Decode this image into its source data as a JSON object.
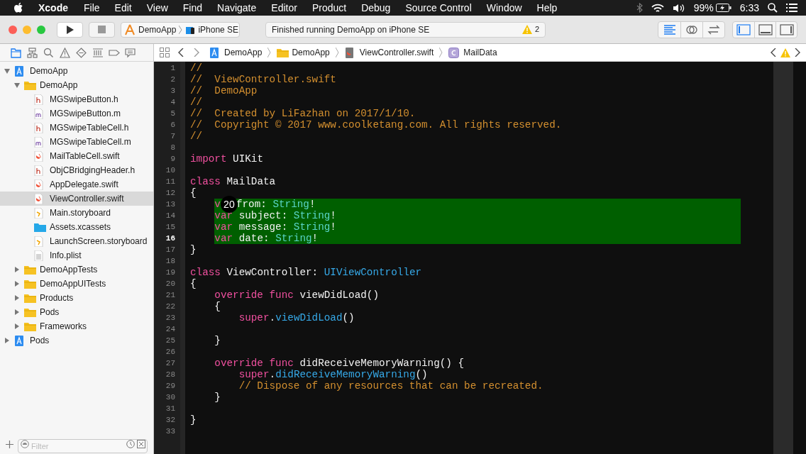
{
  "menu_bar": {
    "app": "Xcode",
    "items": [
      "File",
      "Edit",
      "View",
      "Find",
      "Navigate",
      "Editor",
      "Product",
      "Debug",
      "Source Control",
      "Window",
      "Help"
    ],
    "battery": "99%",
    "time": "6:33"
  },
  "toolbar": {
    "scheme": "DemoApp",
    "device": "iPhone SE",
    "status_text": "Finished running DemoApp on iPhone SE",
    "warnings": "2",
    "editor_modes": [
      {
        "kind": "standard",
        "selected": true
      },
      {
        "kind": "assistant",
        "selected": false
      },
      {
        "kind": "version",
        "selected": false
      }
    ],
    "panels": [
      {
        "kind": "navigator",
        "on": true
      },
      {
        "kind": "debug",
        "on": false
      },
      {
        "kind": "utilities",
        "on": false
      }
    ]
  },
  "navigator_tabs": [
    {
      "kind": "project",
      "selected": true
    },
    {
      "kind": "symbol",
      "selected": false
    },
    {
      "kind": "find",
      "selected": false
    },
    {
      "kind": "issue",
      "selected": false
    },
    {
      "kind": "test",
      "selected": false
    },
    {
      "kind": "debug",
      "selected": false
    },
    {
      "kind": "breakpoint",
      "selected": false
    },
    {
      "kind": "report",
      "selected": false
    }
  ],
  "tree": [
    {
      "name": "DemoApp",
      "kind": "project",
      "expanded": true,
      "selected": false,
      "children": [
        {
          "name": "DemoApp",
          "kind": "folder",
          "expanded": true,
          "selected": false,
          "children": [
            {
              "name": "MGSwipeButton.h",
              "kind": "h",
              "selected": false
            },
            {
              "name": "MGSwipeButton.m",
              "kind": "m",
              "selected": false
            },
            {
              "name": "MGSwipeTableCell.h",
              "kind": "h",
              "selected": false
            },
            {
              "name": "MGSwipeTableCell.m",
              "kind": "m",
              "selected": false
            },
            {
              "name": "MailTableCell.swift",
              "kind": "swift",
              "selected": false
            },
            {
              "name": "ObjCBridgingHeader.h",
              "kind": "h",
              "selected": false
            },
            {
              "name": "AppDelegate.swift",
              "kind": "swift",
              "selected": false
            },
            {
              "name": "ViewController.swift",
              "kind": "swift",
              "selected": true
            },
            {
              "name": "Main.storyboard",
              "kind": "storyboard",
              "selected": false
            },
            {
              "name": "Assets.xcassets",
              "kind": "assets",
              "selected": false
            },
            {
              "name": "LaunchScreen.storyboard",
              "kind": "storyboard",
              "selected": false
            },
            {
              "name": "Info.plist",
              "kind": "plist",
              "selected": false
            }
          ]
        },
        {
          "name": "DemoAppTests",
          "kind": "folder",
          "expanded": false,
          "selected": false
        },
        {
          "name": "DemoAppUITests",
          "kind": "folder",
          "expanded": false,
          "selected": false
        },
        {
          "name": "Products",
          "kind": "folder",
          "expanded": false,
          "selected": false
        },
        {
          "name": "Pods",
          "kind": "folder",
          "expanded": false,
          "selected": false
        },
        {
          "name": "Frameworks",
          "kind": "folder",
          "expanded": false,
          "selected": false
        }
      ]
    },
    {
      "name": "Pods",
      "kind": "project",
      "expanded": false,
      "selected": false
    }
  ],
  "filter": {
    "placeholder": "Filter"
  },
  "jump_bar": [
    {
      "text": "DemoApp",
      "kind": "project"
    },
    {
      "text": "DemoApp",
      "kind": "folder"
    },
    {
      "text": "ViewController.swift",
      "kind": "swift"
    },
    {
      "text": "MailData",
      "kind": "class"
    }
  ],
  "editor": {
    "lines": [
      {
        "number": "1",
        "selected": false,
        "current": false,
        "tokens": [
          {
            "kind": "comment",
            "text": "//"
          }
        ]
      },
      {
        "number": "2",
        "selected": false,
        "current": false,
        "tokens": [
          {
            "kind": "comment",
            "text": "//  ViewController.swift"
          }
        ]
      },
      {
        "number": "3",
        "selected": false,
        "current": false,
        "tokens": [
          {
            "kind": "comment",
            "text": "//  DemoApp"
          }
        ]
      },
      {
        "number": "4",
        "selected": false,
        "current": false,
        "tokens": [
          {
            "kind": "comment",
            "text": "//"
          }
        ]
      },
      {
        "number": "5",
        "selected": false,
        "current": false,
        "tokens": [
          {
            "kind": "comment",
            "text": "//  Created by LiFazhan on 2017/1/10."
          }
        ]
      },
      {
        "number": "6",
        "selected": false,
        "current": false,
        "tokens": [
          {
            "kind": "comment",
            "text": "//  Copyright © 2017 www.coolketang.com. All rights reserved."
          }
        ]
      },
      {
        "number": "7",
        "selected": false,
        "current": false,
        "tokens": [
          {
            "kind": "comment",
            "text": "//"
          }
        ]
      },
      {
        "number": "8",
        "selected": false,
        "current": false
      },
      {
        "number": "9",
        "selected": false,
        "current": false,
        "tokens": [
          {
            "kind": "keyword",
            "text": "import"
          },
          {
            "kind": "plain",
            "text": " UIKit"
          }
        ]
      },
      {
        "number": "10",
        "selected": false,
        "current": false
      },
      {
        "number": "11",
        "selected": false,
        "current": false,
        "tokens": [
          {
            "kind": "keyword",
            "text": "class"
          },
          {
            "kind": "plain",
            "text": " MailData"
          }
        ]
      },
      {
        "number": "12",
        "selected": false,
        "current": false,
        "tokens": [
          {
            "kind": "plain",
            "text": "{"
          }
        ]
      },
      {
        "number": "13",
        "selected": true,
        "current": false,
        "tokens": [
          {
            "kind": "keyword",
            "text": "    v"
          },
          {
            "kind": "badge",
            "text": "20"
          },
          {
            "kind": "plain",
            "text": "from: "
          },
          {
            "kind": "type",
            "text": "String"
          },
          {
            "kind": "plain",
            "text": "!"
          }
        ]
      },
      {
        "number": "14",
        "selected": true,
        "current": false,
        "tokens": [
          {
            "kind": "keyword",
            "text": "    var"
          },
          {
            "kind": "plain",
            "text": " subject: "
          },
          {
            "kind": "type",
            "text": "String"
          },
          {
            "kind": "plain",
            "text": "!"
          }
        ]
      },
      {
        "number": "15",
        "selected": true,
        "current": false,
        "tokens": [
          {
            "kind": "keyword",
            "text": "    var"
          },
          {
            "kind": "plain",
            "text": " message: "
          },
          {
            "kind": "type",
            "text": "String"
          },
          {
            "kind": "plain",
            "text": "!"
          }
        ]
      },
      {
        "number": "16",
        "selected": true,
        "current": true,
        "tokens": [
          {
            "kind": "keyword",
            "text": "    var"
          },
          {
            "kind": "plain",
            "text": " date: "
          },
          {
            "kind": "type",
            "text": "String"
          },
          {
            "kind": "plain",
            "text": "!"
          }
        ]
      },
      {
        "number": "17",
        "selected": false,
        "current": false,
        "tokens": [
          {
            "kind": "plain",
            "text": "}"
          }
        ]
      },
      {
        "number": "18",
        "selected": false,
        "current": false
      },
      {
        "number": "19",
        "selected": false,
        "current": false,
        "tokens": [
          {
            "kind": "keyword",
            "text": "class"
          },
          {
            "kind": "plain",
            "text": " ViewController: "
          },
          {
            "kind": "call",
            "text": "UIViewController"
          }
        ]
      },
      {
        "number": "20",
        "selected": false,
        "current": false,
        "tokens": [
          {
            "kind": "plain",
            "text": "{"
          }
        ]
      },
      {
        "number": "21",
        "selected": false,
        "current": false,
        "tokens": [
          {
            "kind": "keyword",
            "text": "    override func"
          },
          {
            "kind": "plain",
            "text": " viewDidLoad()"
          }
        ]
      },
      {
        "number": "22",
        "selected": false,
        "current": false,
        "tokens": [
          {
            "kind": "plain",
            "text": "    {"
          }
        ]
      },
      {
        "number": "23",
        "selected": false,
        "current": false,
        "tokens": [
          {
            "kind": "keyword",
            "text": "        super"
          },
          {
            "kind": "plain",
            "text": "."
          },
          {
            "kind": "call",
            "text": "viewDidLoad"
          },
          {
            "kind": "plain",
            "text": "()"
          }
        ]
      },
      {
        "number": "24",
        "selected": false,
        "current": false
      },
      {
        "number": "25",
        "selected": false,
        "current": false,
        "tokens": [
          {
            "kind": "plain",
            "text": "    }"
          }
        ]
      },
      {
        "number": "26",
        "selected": false,
        "current": false
      },
      {
        "number": "27",
        "selected": false,
        "current": false,
        "tokens": [
          {
            "kind": "keyword",
            "text": "    override func"
          },
          {
            "kind": "plain",
            "text": " didReceiveMemoryWarning() {"
          }
        ]
      },
      {
        "number": "28",
        "selected": false,
        "current": false,
        "tokens": [
          {
            "kind": "keyword",
            "text": "        super"
          },
          {
            "kind": "plain",
            "text": "."
          },
          {
            "kind": "call",
            "text": "didReceiveMemoryWarning"
          },
          {
            "kind": "plain",
            "text": "()"
          }
        ]
      },
      {
        "number": "29",
        "selected": false,
        "current": false,
        "tokens": [
          {
            "kind": "comment",
            "text": "        // Dispose of any resources that can be recreated."
          }
        ]
      },
      {
        "number": "30",
        "selected": false,
        "current": false,
        "tokens": [
          {
            "kind": "plain",
            "text": "    }"
          }
        ]
      },
      {
        "number": "31",
        "selected": false,
        "current": false
      },
      {
        "number": "32",
        "selected": false,
        "current": false,
        "tokens": [
          {
            "kind": "plain",
            "text": "}"
          }
        ]
      },
      {
        "number": "33",
        "selected": false,
        "current": false
      }
    ]
  }
}
